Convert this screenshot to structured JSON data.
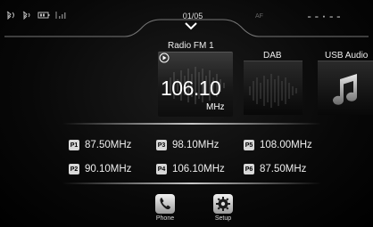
{
  "status": {
    "icons": [
      "bluetooth-phone-icon",
      "bluetooth-audio-icon",
      "battery-icon",
      "signal-icon"
    ],
    "page_counter": "01/05",
    "af_label": "AF",
    "clock": "--·--"
  },
  "sources": {
    "fm": {
      "label": "Radio FM 1",
      "frequency": "106.10",
      "unit": "MHz"
    },
    "dab": {
      "label": "DAB"
    },
    "usb": {
      "label": "USB Audio"
    }
  },
  "presets": [
    {
      "badge": "P1",
      "freq": "87.50MHz"
    },
    {
      "badge": "P2",
      "freq": "90.10MHz"
    },
    {
      "badge": "P3",
      "freq": "98.10MHz"
    },
    {
      "badge": "P4",
      "freq": "106.10MHz"
    },
    {
      "badge": "P5",
      "freq": "108.00MHz"
    },
    {
      "badge": "P6",
      "freq": "87.50MHz"
    }
  ],
  "apps": [
    {
      "label": "Phone",
      "icon": "phone-icon"
    },
    {
      "label": "Setup",
      "icon": "settings-icon"
    }
  ]
}
